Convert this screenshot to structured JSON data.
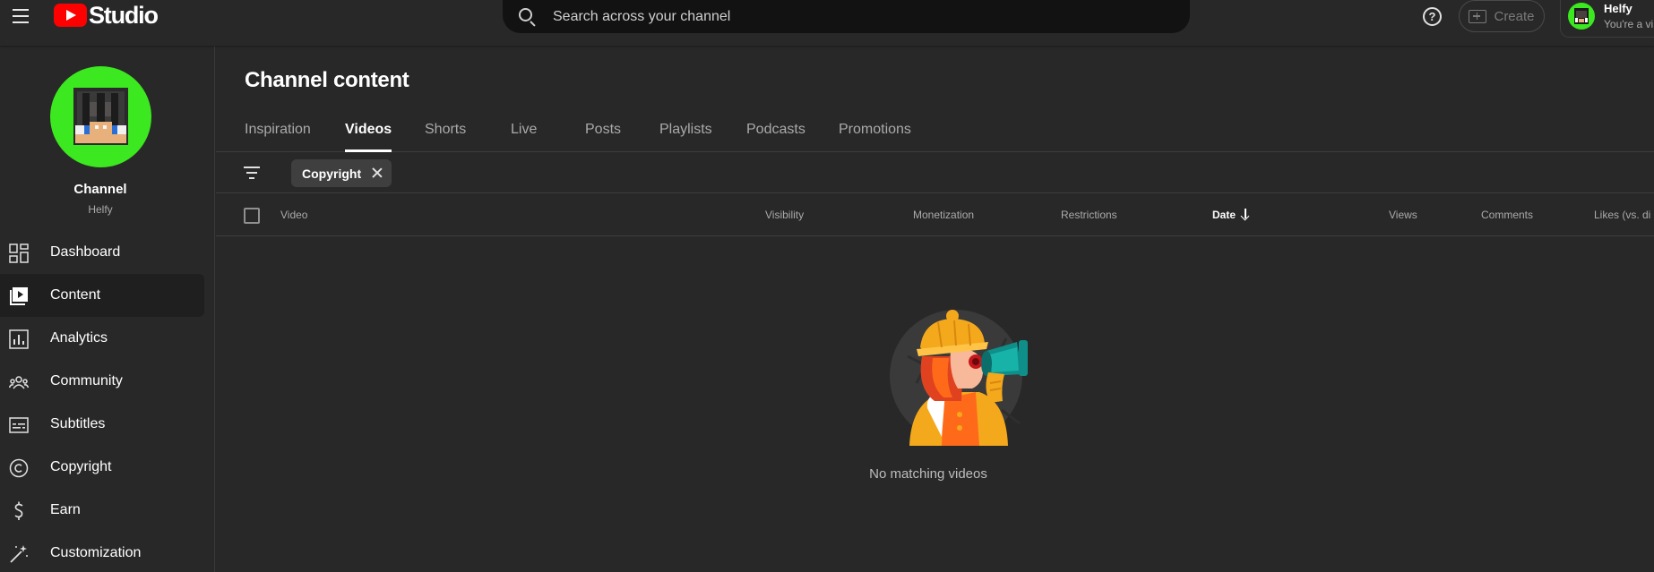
{
  "header": {
    "logo_text": "Studio",
    "search_placeholder": "Search across your channel",
    "create_label": "Create",
    "account_name": "Helfy",
    "account_sub": "You're a vi"
  },
  "sidebar": {
    "channel_title": "Channel",
    "channel_sub": "Helfy",
    "items": [
      {
        "label": "Dashboard",
        "icon": "dashboard-icon"
      },
      {
        "label": "Content",
        "icon": "content-icon",
        "active": true
      },
      {
        "label": "Analytics",
        "icon": "analytics-icon"
      },
      {
        "label": "Community",
        "icon": "community-icon"
      },
      {
        "label": "Subtitles",
        "icon": "subtitles-icon"
      },
      {
        "label": "Copyright",
        "icon": "copyright-icon"
      },
      {
        "label": "Earn",
        "icon": "earn-icon"
      },
      {
        "label": "Customization",
        "icon": "customization-icon"
      }
    ]
  },
  "main": {
    "title": "Channel content",
    "tabs": [
      "Inspiration",
      "Videos",
      "Shorts",
      "Live",
      "Posts",
      "Playlists",
      "Podcasts",
      "Promotions"
    ],
    "active_tab": "Videos",
    "filter_chip": "Copyright",
    "columns": [
      "Video",
      "Visibility",
      "Monetization",
      "Restrictions",
      "Date",
      "Views",
      "Comments",
      "Likes (vs. di"
    ],
    "sorted_column": "Date",
    "empty_message": "No matching videos"
  },
  "colors": {
    "background": "#282828",
    "search_bg": "#121212",
    "avatar_green": "#3ce81f",
    "brand_red": "#ff0000",
    "active_nav": "#1f1f1f"
  }
}
